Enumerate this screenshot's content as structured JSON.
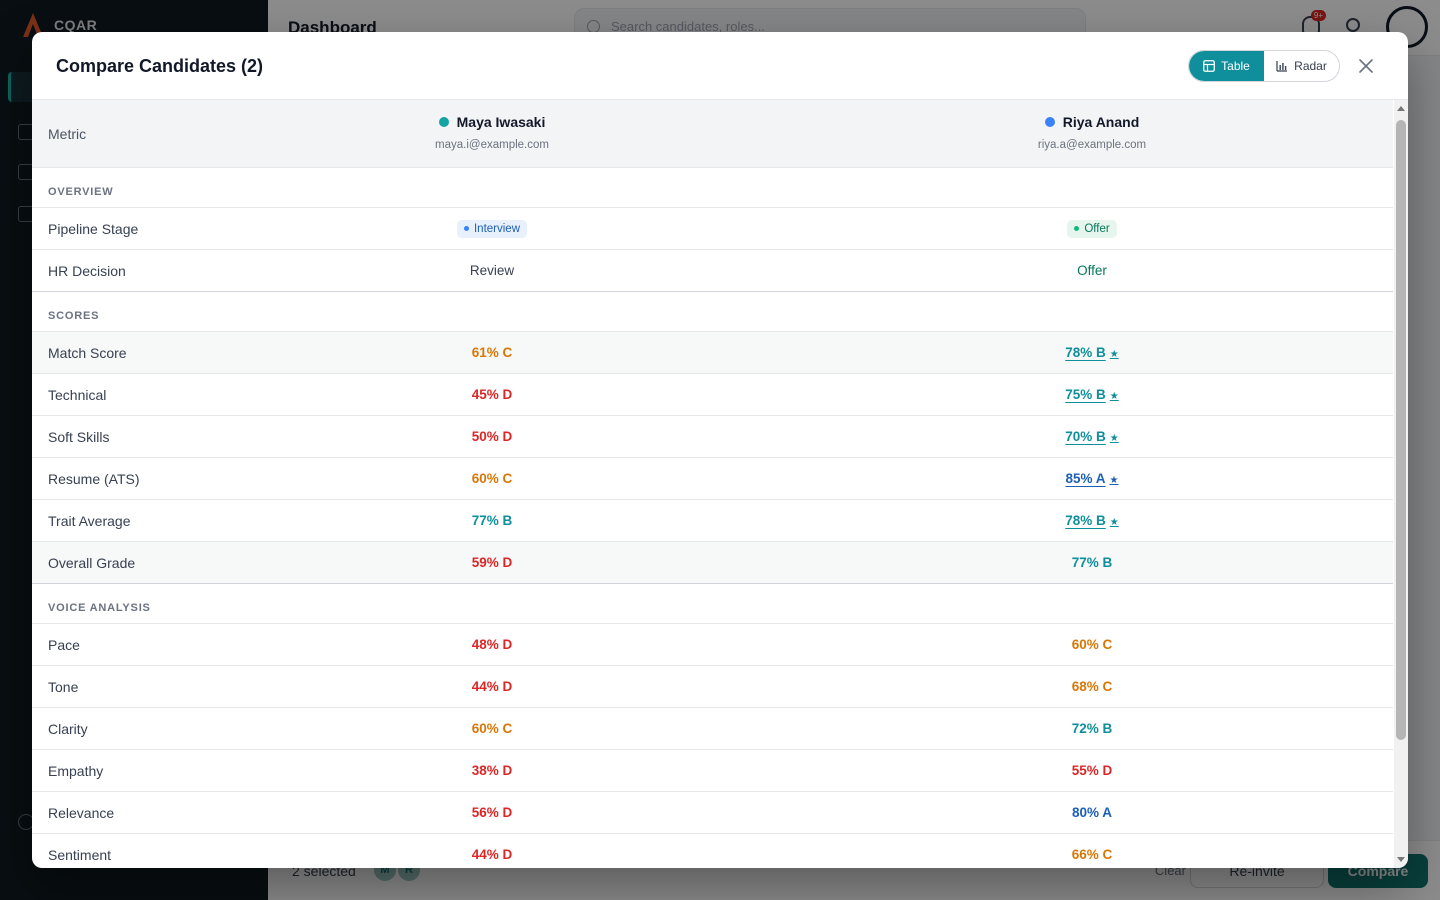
{
  "app": {
    "brand": "CQAR",
    "page_title": "Dashboard",
    "search_placeholder": "Search candidates, roles...",
    "notif_badge": "9+",
    "selection_text": "2 selected",
    "chips": [
      "M",
      "R"
    ],
    "clear_label": "Clear",
    "reinvite_label": "Re-invite",
    "compare_label": "Compare"
  },
  "modal": {
    "title": "Compare Candidates (2)",
    "view_table": "Table",
    "view_radar": "Radar",
    "active_view": "Table",
    "metric_header": "Metric",
    "candidates": [
      {
        "name": "Maya Iwasaki",
        "email": "maya.i@example.com",
        "color": "#14a3a3"
      },
      {
        "name": "Riya Anand",
        "email": "riya.a@example.com",
        "color": "#3b82f6"
      }
    ],
    "sections": [
      {
        "title": "OVERVIEW",
        "rows": [
          {
            "label": "Pipeline Stage",
            "v1": "Interview",
            "v2": "Offer"
          },
          {
            "label": "HR Decision",
            "v1": "Review",
            "v2": "Offer"
          }
        ]
      },
      {
        "title": "SCORES",
        "rows": [
          {
            "label": "Match Score",
            "v1": "61% C",
            "v2": "78% B",
            "best": 2
          },
          {
            "label": "Technical",
            "v1": "45% D",
            "v2": "75% B",
            "best": 2
          },
          {
            "label": "Soft Skills",
            "v1": "50% D",
            "v2": "70% B",
            "best": 2
          },
          {
            "label": "Resume (ATS)",
            "v1": "60% C",
            "v2": "85% A",
            "best": 2
          },
          {
            "label": "Trait Average",
            "v1": "77% B",
            "v2": "78% B",
            "best": 2
          },
          {
            "label": "Overall Grade",
            "v1": "59% D",
            "v2": "77% B"
          }
        ]
      },
      {
        "title": "VOICE ANALYSIS",
        "rows": [
          {
            "label": "Pace",
            "v1": "48% D",
            "v2": "60% C"
          },
          {
            "label": "Tone",
            "v1": "44% D",
            "v2": "68% C"
          },
          {
            "label": "Clarity",
            "v1": "60% C",
            "v2": "72% B"
          },
          {
            "label": "Empathy",
            "v1": "38% D",
            "v2": "55% D"
          },
          {
            "label": "Relevance",
            "v1": "56% D",
            "v2": "80% A"
          },
          {
            "label": "Sentiment",
            "v1": "44% D",
            "v2": "66% C"
          }
        ]
      }
    ],
    "best_marker": "★"
  }
}
